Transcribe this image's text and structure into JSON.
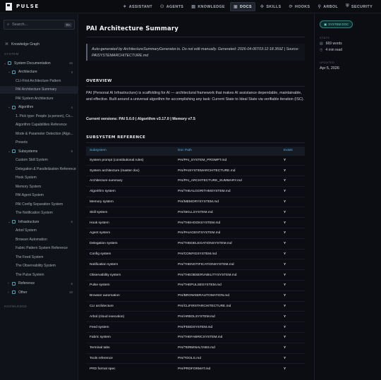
{
  "app": {
    "name": "PULSE"
  },
  "nav": [
    {
      "label": "ASSISTANT",
      "icon": "✦",
      "active": false
    },
    {
      "label": "AGENTS",
      "icon": "⚇",
      "active": false
    },
    {
      "label": "KNOWLEDGE",
      "icon": "▤",
      "active": false
    },
    {
      "label": "DOCS",
      "icon": "▣",
      "active": true
    },
    {
      "label": "SKILLS",
      "icon": "✣",
      "active": false
    },
    {
      "label": "HOOKS",
      "icon": "⟳",
      "active": false
    },
    {
      "label": "ARBOL",
      "icon": "⚲",
      "active": false
    },
    {
      "label": "SECURITY",
      "icon": "⛨",
      "active": false
    }
  ],
  "sidebar": {
    "search_placeholder": "Search...",
    "search_kbd": "⌘K",
    "knowledge_graph": "Knowledge Graph",
    "section_system": "SYSTEM",
    "section_knowledge": "KNOWLEDGE",
    "rows": [
      {
        "label": "System Documentation",
        "count": "45",
        "level": 0,
        "type": "group"
      },
      {
        "label": "Architecture",
        "count": "3",
        "level": 1,
        "type": "group"
      },
      {
        "label": "CLI-First Architecture Pattern",
        "count": "",
        "level": 2,
        "type": "leaf"
      },
      {
        "label": "PAI Architecture Summary",
        "count": "",
        "level": 2,
        "type": "leaf",
        "active": true
      },
      {
        "label": "PAI System Architecture",
        "count": "",
        "level": 2,
        "type": "leaf"
      },
      {
        "label": "Algorithm",
        "count": "4",
        "level": 1,
        "type": "group"
      },
      {
        "label": "1. Pick type: People (a person), Co...",
        "count": "",
        "level": 2,
        "type": "leaf"
      },
      {
        "label": "Algorithm Capabilities Reference",
        "count": "",
        "level": 2,
        "type": "leaf"
      },
      {
        "label": "Mode & Parameter Detection (Algo...",
        "count": "",
        "level": 2,
        "type": "leaf"
      },
      {
        "label": "Presets",
        "count": "",
        "level": 2,
        "type": "leaf"
      },
      {
        "label": "Subsystems",
        "count": "8",
        "level": 1,
        "type": "group"
      },
      {
        "label": "Custom Skill System",
        "count": "",
        "level": 2,
        "type": "leaf"
      },
      {
        "label": "Delegation & Parallelization Reference",
        "count": "",
        "level": 2,
        "type": "leaf"
      },
      {
        "label": "Hook System",
        "count": "",
        "level": 2,
        "type": "leaf"
      },
      {
        "label": "Memory System",
        "count": "",
        "level": 2,
        "type": "leaf"
      },
      {
        "label": "PAI Agent System",
        "count": "",
        "level": 2,
        "type": "leaf"
      },
      {
        "label": "PAI Config Separation System",
        "count": "",
        "level": 2,
        "type": "leaf"
      },
      {
        "label": "The Notification System",
        "count": "",
        "level": 2,
        "type": "leaf"
      },
      {
        "label": "Infrastructure",
        "count": "6",
        "level": 1,
        "type": "group"
      },
      {
        "label": "Arbol System",
        "count": "",
        "level": 2,
        "type": "leaf"
      },
      {
        "label": "Browser Automation",
        "count": "",
        "level": 2,
        "type": "leaf"
      },
      {
        "label": "Fabric Pattern System Reference",
        "count": "",
        "level": 2,
        "type": "leaf"
      },
      {
        "label": "The Feed System",
        "count": "",
        "level": 2,
        "type": "leaf"
      },
      {
        "label": "The Observability System",
        "count": "",
        "level": 2,
        "type": "leaf"
      },
      {
        "label": "The Pulse System",
        "count": "",
        "level": 2,
        "type": "leaf"
      },
      {
        "label": "Reference",
        "count": "6",
        "level": 1,
        "type": "collapsed"
      },
      {
        "label": "Other",
        "count": "18",
        "level": 1,
        "type": "collapsed"
      }
    ]
  },
  "doc": {
    "title": "PAI Architecture Summary",
    "notice": "Auto-generated by ArchitectureSummaryGenerator.ts. Do not edit manually. Generated: 2026-04-06T03:12:18.359Z | Source: PAISYSTEMARCHITECTURE.md",
    "overview_heading": "OVERVIEW",
    "overview_text": "PAI (Personal AI Infrastructure) is scaffolding for AI — architectural framework that makes AI assistance dependable, maintainable, and effective. Built around a universal algorithm for accomplishing any task: Current State to Ideal State via verifiable iteration (ISC).",
    "versions": "Current versions: PAI 5.0.0 | Algorithm v3.17.0 | Memory v7.5",
    "subsystem_heading": "SUBSYSTEM REFERENCE",
    "table": {
      "columns": [
        "Subsystem",
        "Doc Path",
        "Exists"
      ],
      "rows": [
        [
          "System prompt (constitutional rules)",
          "PAI/PAI_SYSTEM_PROMPT.md",
          "Y"
        ],
        [
          "System architecture (master doc)",
          "PAI/PAISYSTEMARCHITECTURE.md",
          "Y"
        ],
        [
          "Architecture summary",
          "PAI/PAI_ARCHITECTURE_SUMMARY.md",
          "Y"
        ],
        [
          "Algorithm system",
          "PAI/THEALGORITHMSYSTEM.md",
          "Y"
        ],
        [
          "Memory system",
          "PAI/MEMORYSYSTEM.md",
          "Y"
        ],
        [
          "Skill system",
          "PAI/SKILLSYSTEM.md",
          "Y"
        ],
        [
          "Hook system",
          "PAI/THEHOOKSYSTEM.md",
          "Y"
        ],
        [
          "Agent system",
          "PAI/PAIAGENTSYSTEM.md",
          "Y"
        ],
        [
          "Delegation system",
          "PAI/THEDELEGATIONSYSTEM.md",
          "Y"
        ],
        [
          "Config system",
          "PAI/CONFIGSYSTEM.md",
          "Y"
        ],
        [
          "Notification system",
          "PAI/THENOTIFICATIONSYSTEM.md",
          "Y"
        ],
        [
          "Observability system",
          "PAI/THEOBSERVABILITYSYSTEM.md",
          "Y"
        ],
        [
          "Pulse system",
          "PAI/THEPULSESYSTEM.md",
          "Y"
        ],
        [
          "Browser automation",
          "PAI/BROWSERAUTOMATION.md",
          "Y"
        ],
        [
          "CLI architecture",
          "PAI/CLIFIRSTARCHITECTURE.md",
          "Y"
        ],
        [
          "Arbol (cloud execution)",
          "PAI/ARBOLSYSTEM.md",
          "Y"
        ],
        [
          "Feed system",
          "PAI/FEEDSYSTEM.md",
          "Y"
        ],
        [
          "Fabric system",
          "PAI/THEFABRICSYSTEM.md",
          "Y"
        ],
        [
          "Terminal tabs",
          "PAI/TERMINALTABS.md",
          "Y"
        ],
        [
          "Tools reference",
          "PAI/TOOLS.md",
          "Y"
        ],
        [
          "PRD format spec",
          "PAI/PRDFORMAT.md",
          "Y"
        ]
      ]
    }
  },
  "meta": {
    "badge": "SYSTEM DOC",
    "stats_label": "STATS",
    "words": "669 words",
    "read_time": "4 min read",
    "updated_label": "UPDATED",
    "updated": "Apr 5, 2026"
  },
  "colors": {
    "accent": "#2fb6b0",
    "link": "#56b3e8",
    "background": "#0b0d12"
  }
}
